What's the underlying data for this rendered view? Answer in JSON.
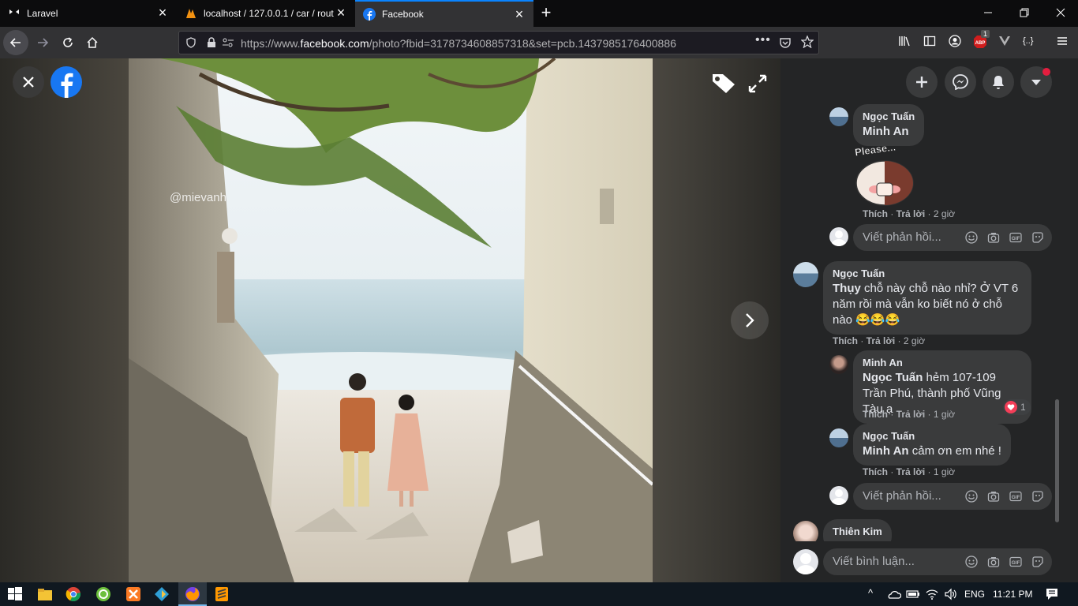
{
  "browser": {
    "tabs": [
      {
        "title": "Laravel"
      },
      {
        "title": "localhost / 127.0.0.1 / car / rout"
      },
      {
        "title": "Facebook"
      }
    ],
    "url_prefix": "https://www.",
    "url_domain": "facebook.com",
    "url_rest": "/photo?fbid=3178734608857318&set=pcb.1437985176400886",
    "abp_count": "1"
  },
  "photo": {
    "watermark": "@mievanh"
  },
  "panel": {
    "comments": [
      {
        "name": "Ngọc Tuấn",
        "tag": "Minh An",
        "text": "",
        "sticker": "Please...",
        "like": "Thích",
        "reply": "Trả lời",
        "time": "2 giờ"
      },
      {
        "name": "Ngọc Tuấn",
        "tag": "Thụy",
        "text": " chỗ này chỗ nào nhỉ? Ở VT 6 năm rồi mà vẫn ko biết nó ở chỗ nào 😂😂😂",
        "like": "Thích",
        "reply": "Trả lời",
        "time": "2 giờ"
      },
      {
        "name": "Minh An",
        "tag": "Ngọc Tuấn",
        "text": " hẻm 107-109 Trần Phú, thành phố Vũng Tàu ạ",
        "reaction_count": "1",
        "like": "Thích",
        "reply": "Trả lời",
        "time": "1 giờ"
      },
      {
        "name": "Ngọc Tuấn",
        "tag": "Minh An",
        "text": " cảm ơn em nhé !",
        "like": "Thích",
        "reply": "Trả lời",
        "time": "1 giờ"
      },
      {
        "name": "Thiên Kim"
      }
    ],
    "reply_placeholder": "Viết phản hồi...",
    "comment_placeholder": "Viết bình luận..."
  },
  "taskbar": {
    "lang": "ENG",
    "time": "11:21 PM"
  },
  "colors": {
    "accent": "#0a84ff",
    "facebook_blue": "#1877f2",
    "panel_bg": "#242526",
    "bubble_bg": "#3a3b3c"
  }
}
